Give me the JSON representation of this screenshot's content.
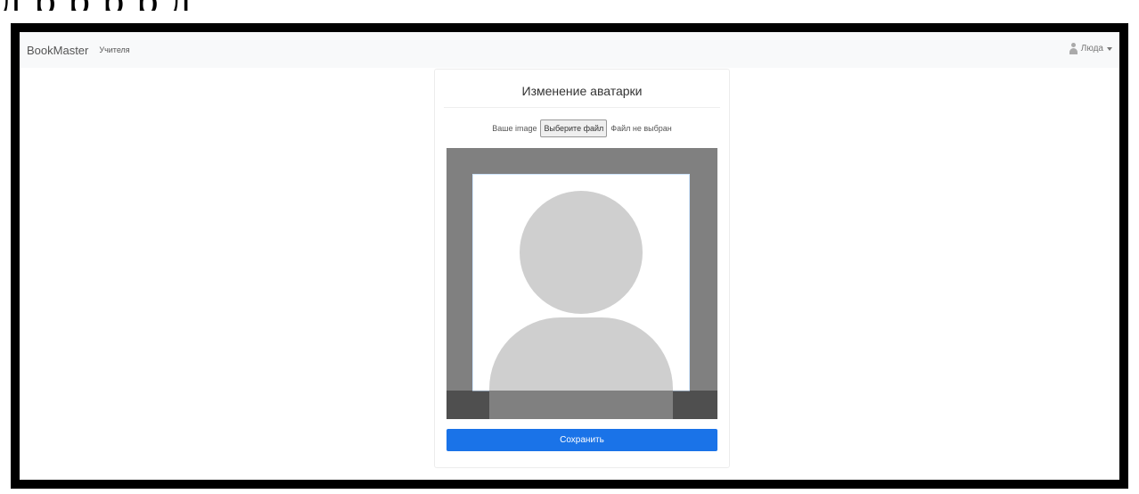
{
  "caption": {
    "text": "д   р р р   р   д"
  },
  "navbar": {
    "brand": "BookMaster",
    "nav_link": "Учителя",
    "user_label": "Люда"
  },
  "card": {
    "title": "Изменение аватарки",
    "file_label": "Ваше image",
    "file_button": "Выберите файл",
    "file_status": "Файл не выбран",
    "save_button": "Сохранить"
  },
  "colors": {
    "primary": "#1a73e8",
    "crop_background": "#808080",
    "avatar_placeholder": "#cfcfcf"
  }
}
